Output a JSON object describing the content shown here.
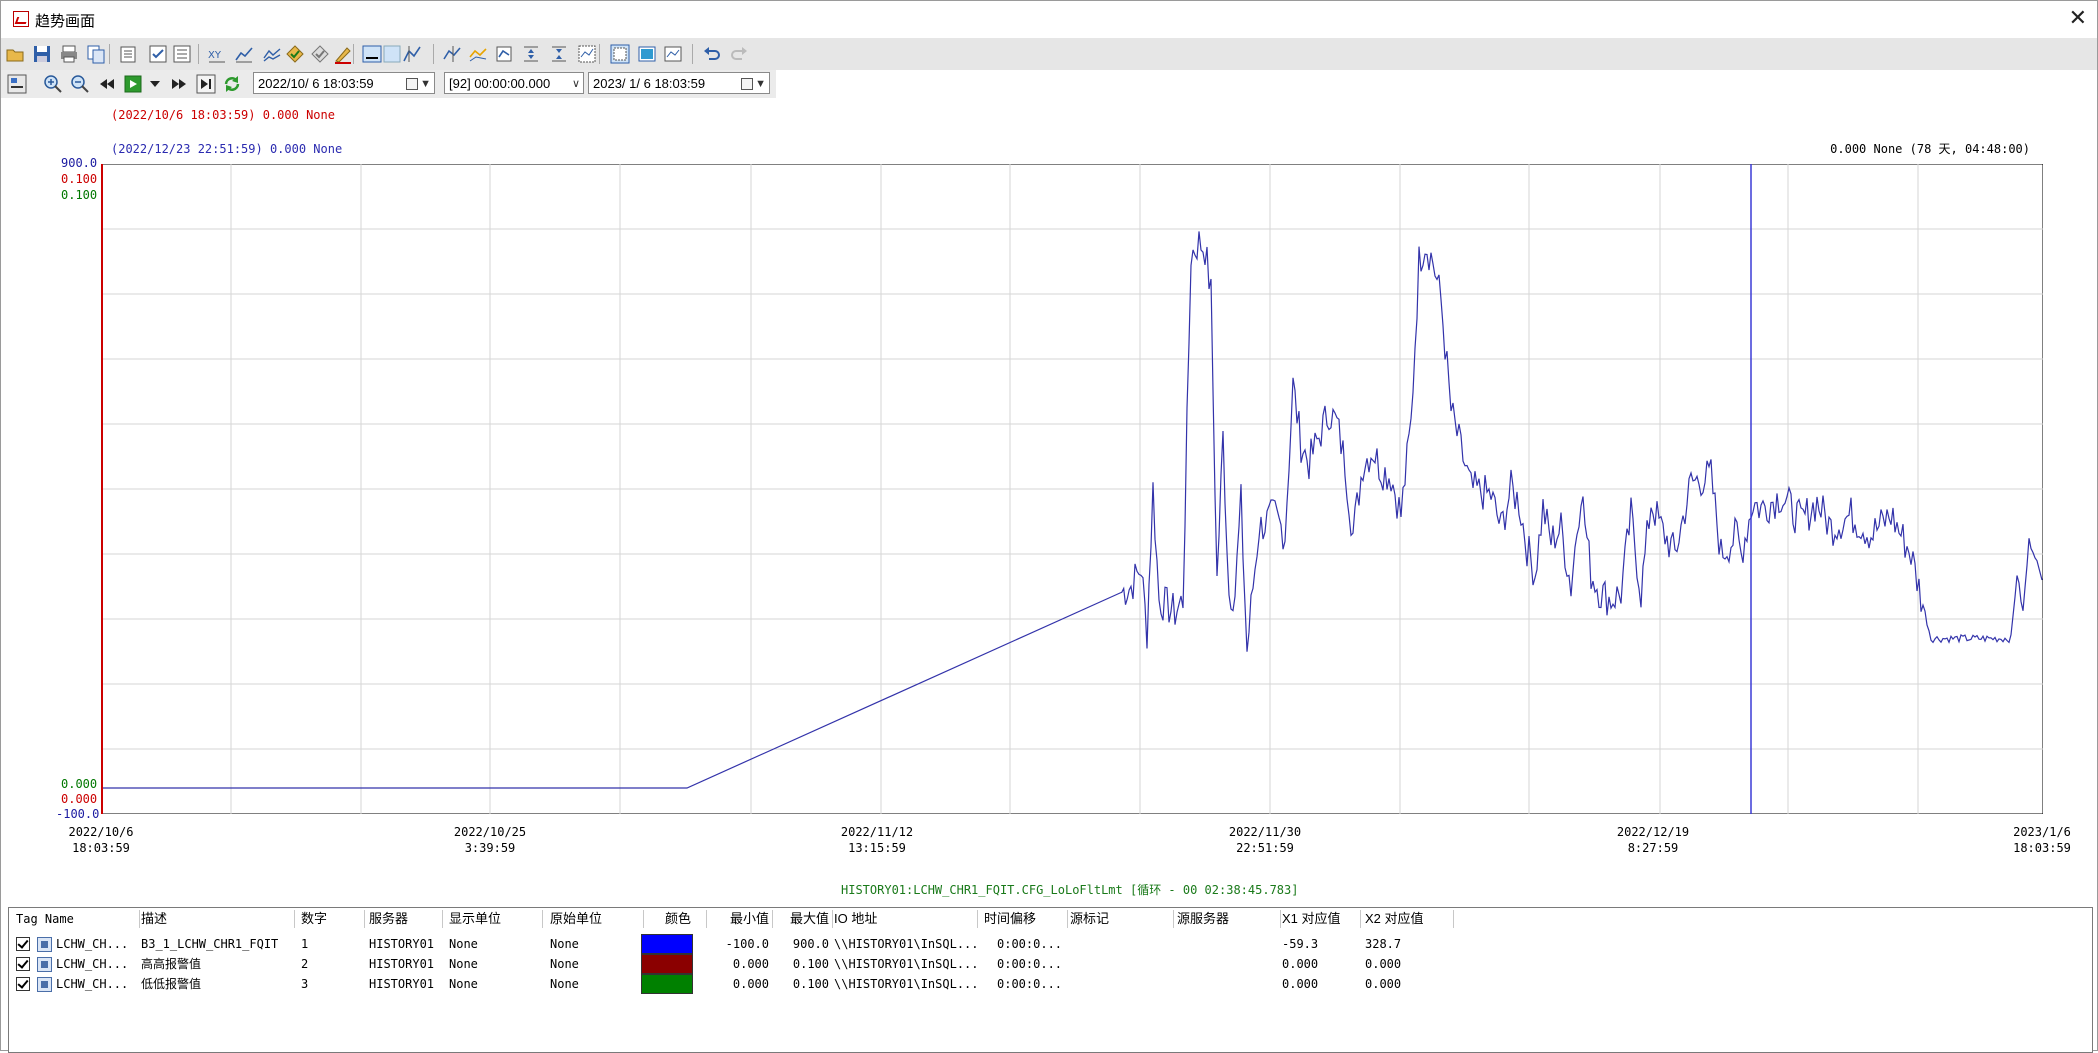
{
  "window": {
    "title": "趋势画面",
    "close_glyph": "✕"
  },
  "toolbar": {
    "buttons": [
      "open",
      "save",
      "print",
      "copy",
      "export",
      "properties",
      "check",
      "list",
      "xy-plot",
      "line-chart",
      "multi-chart",
      "alarm-tag",
      "tag-check",
      "pen",
      "frame",
      "fill",
      "cursor-a",
      "cursor-b",
      "cursor-c",
      "zoom-box",
      "adjust",
      "compress",
      "select",
      "grid-view",
      "snapshot",
      "undo",
      "redo"
    ]
  },
  "timebar": {
    "start_time": "2022/10/ 6 18:03:59",
    "duration": "[92] 00:00:00.000",
    "end_time": "2023/ 1/ 6 18:03:59"
  },
  "plot": {
    "cursor1_readout": "(2022/10/6 18:03:59) 0.000 None",
    "cursor2_readout": "(2022/12/23 22:51:59) 0.000 None",
    "right_readout": "0.000 None (78 天, 04:48:00)",
    "status": "HISTORY01:LCHW_CHR1_FQIT.CFG_LoLoFltLmt [循环 - 00 02:38:45.783]",
    "y_axis": {
      "blue_top": "900.0",
      "blue_bottom": "-100.0",
      "red_top": "0.100",
      "red_bottom": "0.000",
      "green_top": "0.100",
      "green_bottom": "0.000"
    },
    "x_labels": [
      {
        "date": "2022/10/6",
        "time": "18:03:59"
      },
      {
        "date": "2022/10/25",
        "time": "3:39:59"
      },
      {
        "date": "2022/11/12",
        "time": "13:15:59"
      },
      {
        "date": "2022/11/30",
        "time": "22:51:59"
      },
      {
        "date": "2022/12/19",
        "time": "8:27:59"
      },
      {
        "date": "2023/1/6",
        "time": "18:03:59"
      }
    ],
    "colors": {
      "blue": "#3333aa",
      "red": "#cc0000",
      "green": "#007700",
      "cursor": "#3b3bd6"
    }
  },
  "table": {
    "headers": [
      "Tag Name",
      "描述",
      "数字",
      "服务器",
      "显示单位",
      "原始单位",
      "颜色",
      "最小值",
      "最大值",
      "IO 地址",
      "时间偏移",
      "源标记",
      "源服务器",
      "X1 对应值",
      "X2 对应值"
    ],
    "rows": [
      {
        "tag": "LCHW_CH...",
        "desc": "B3_1_LCHW_CHR1_FQIT",
        "num": "1",
        "server": "HISTORY01",
        "disp_unit": "None",
        "raw_unit": "None",
        "color": "#0000ff",
        "min": "-100.0",
        "max": "900.0",
        "io": "\\\\HISTORY01\\InSQL...",
        "offset": "0:00:0...",
        "x1": "-59.3",
        "x2": "328.7"
      },
      {
        "tag": "LCHW_CH...",
        "desc": "高高报警值",
        "num": "2",
        "server": "HISTORY01",
        "disp_unit": "None",
        "raw_unit": "None",
        "color": "#8b0000",
        "min": "0.000",
        "max": "0.100",
        "io": "\\\\HISTORY01\\InSQL...",
        "offset": "0:00:0...",
        "x1": "0.000",
        "x2": "0.000"
      },
      {
        "tag": "LCHW_CH...",
        "desc": "低低报警值",
        "num": "3",
        "server": "HISTORY01",
        "disp_unit": "None",
        "raw_unit": "None",
        "color": "#008000",
        "min": "0.000",
        "max": "0.100",
        "io": "\\\\HISTORY01\\InSQL...",
        "offset": "0:00:0...",
        "x1": "0.000",
        "x2": "0.000"
      }
    ]
  }
}
